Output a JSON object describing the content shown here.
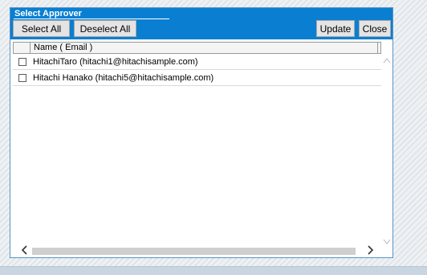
{
  "dialog": {
    "title": "Select Approver",
    "toolbar": {
      "select_all": "Select All",
      "deselect_all": "Deselect All",
      "update": "Update",
      "close": "Close"
    }
  },
  "table": {
    "columns": [
      "Name ( Email )"
    ],
    "rows": [
      {
        "checked": false,
        "label": "HitachiTaro (hitachi1@hitachisample.com)"
      },
      {
        "checked": false,
        "label": "Hitachi Hanako (hitachi5@hitachisample.com)"
      }
    ]
  },
  "icons": {
    "scroll_up": "chevron-up-icon",
    "scroll_down": "chevron-down-icon",
    "scroll_left": "chevron-left-icon",
    "scroll_right": "chevron-right-icon"
  },
  "colors": {
    "titlebar": "#0a7fd1",
    "button_bg": "#e4e4e4"
  }
}
